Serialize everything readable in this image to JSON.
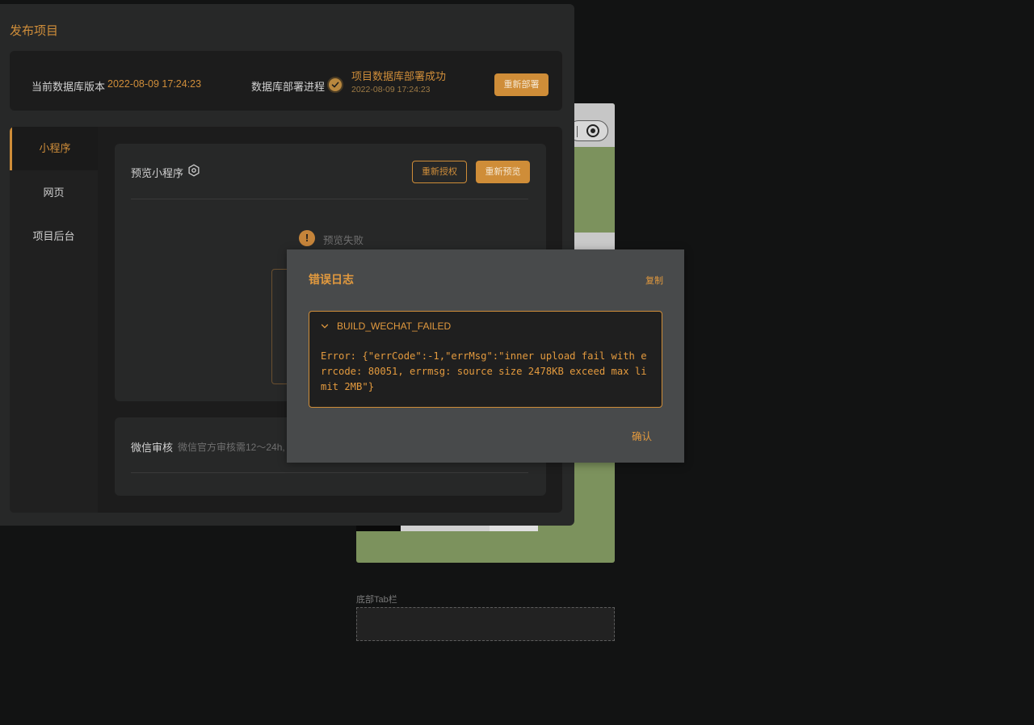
{
  "panel": {
    "title": "发布项目"
  },
  "database": {
    "version_label": "当前数据库版本",
    "version_date": "2022-08-09 17:24:23",
    "deploy_label": "数据库部署进程",
    "deploy_status": "项目数据库部署成功",
    "deploy_time": "2022-08-09 17:24:23",
    "redeploy_button": "重新部署"
  },
  "sidebar": {
    "items": [
      {
        "label": "小程序",
        "active": true
      },
      {
        "label": "网页",
        "active": false
      },
      {
        "label": "项目后台",
        "active": false
      }
    ]
  },
  "preview": {
    "title": "预览小程序",
    "reauth_button": "重新授权",
    "repreview_button": "重新预览",
    "status_text": "预览失败"
  },
  "review": {
    "title": "微信审核",
    "description": "微信官方审核需12～24h,"
  },
  "modal": {
    "title": "错误日志",
    "copy_label": "复制",
    "log_title": "BUILD_WECHAT_FAILED",
    "log_body": "Error: {\"errCode\":-1,\"errMsg\":\"inner upload fail with errcode: 80051, errmsg: source size 2478KB exceed max limit 2MB\"}",
    "confirm_label": "确认"
  },
  "phone_preview": {
    "tabbar_label": "底部Tab栏"
  },
  "colors": {
    "accent": "#cf8d38",
    "background": "#121313",
    "panel": "#272828",
    "card": "#1c1c1c",
    "modal": "#484a4b"
  }
}
